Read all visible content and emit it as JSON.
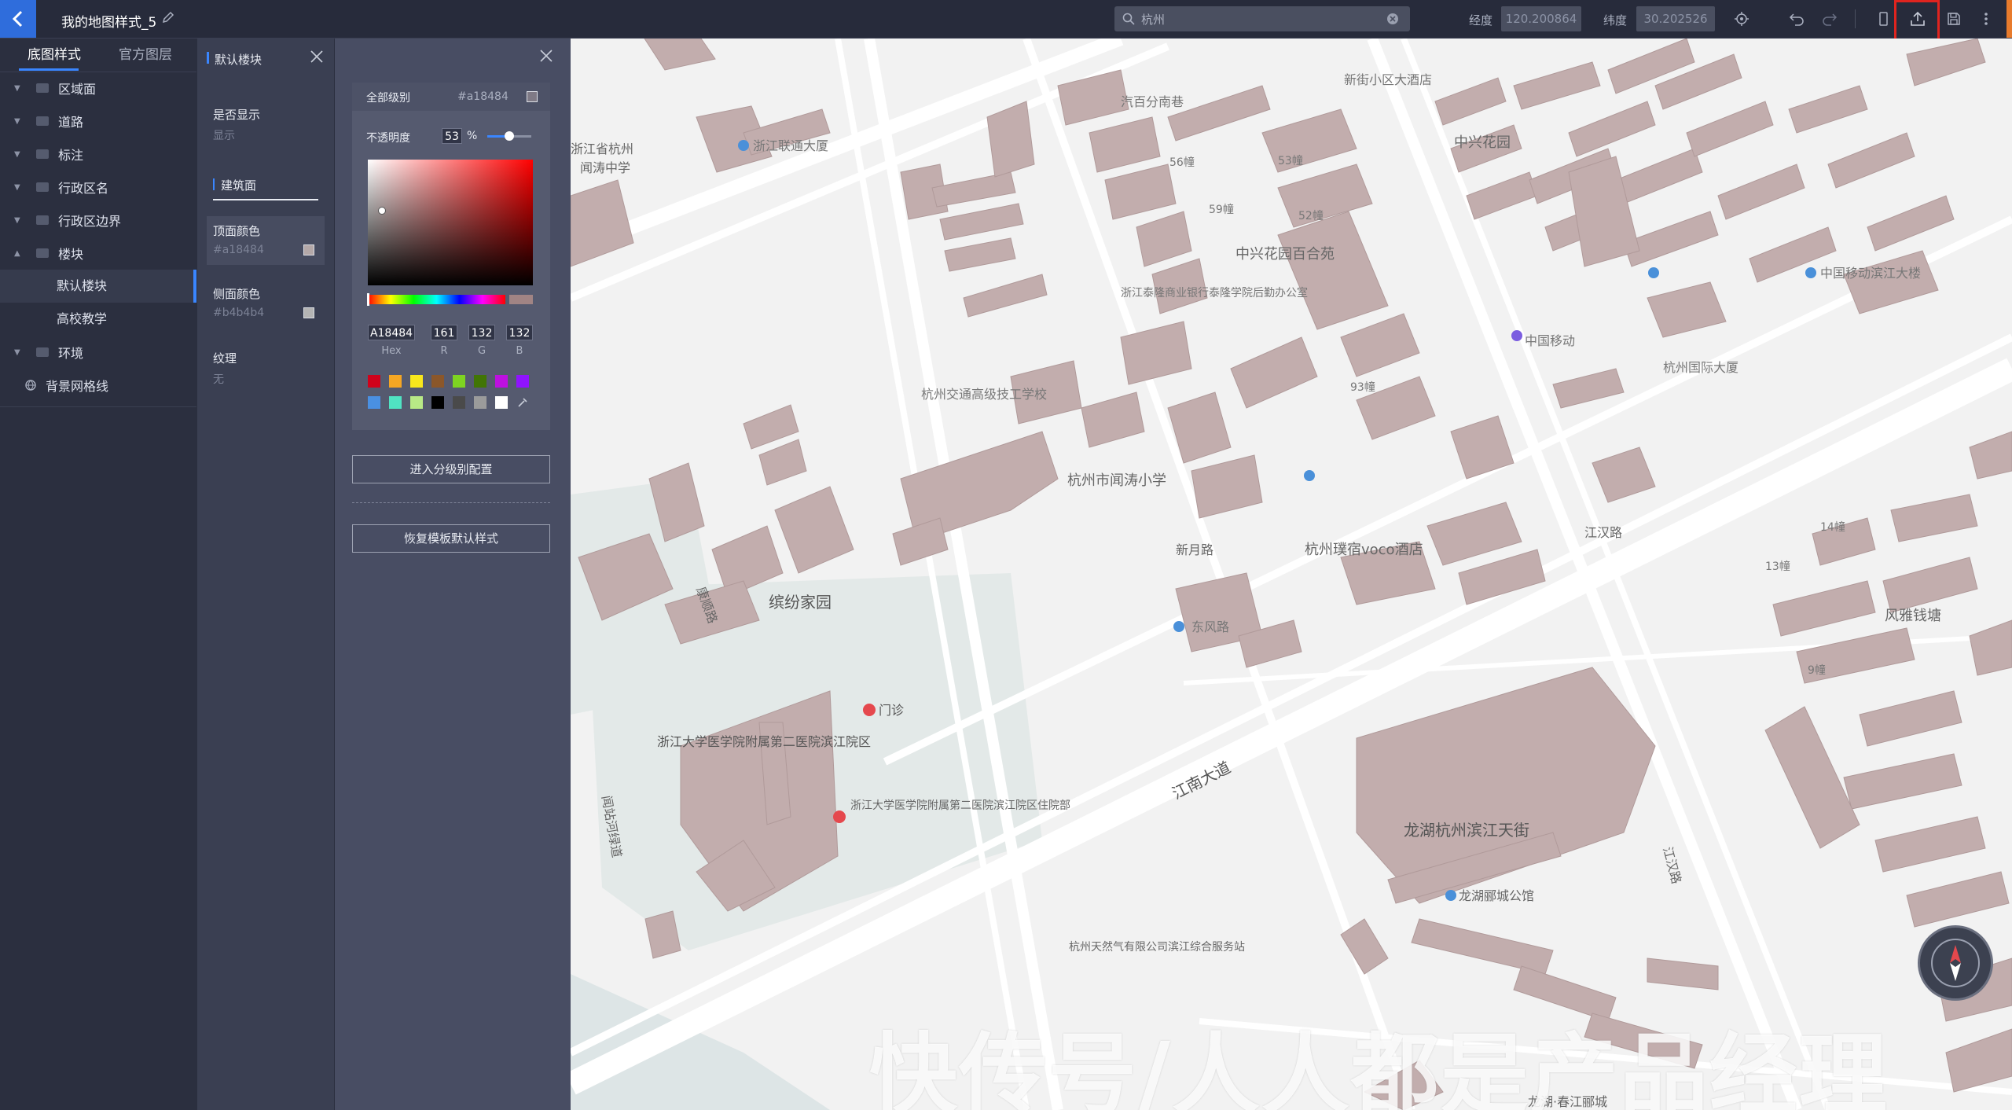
{
  "header": {
    "title": "我的地图样式_5",
    "search_value": "杭州",
    "longitude_label": "经度",
    "longitude_value": "120.200864",
    "latitude_label": "纬度",
    "latitude_value": "30.202526",
    "icons": [
      "back-icon",
      "edit-icon",
      "search-icon",
      "clear-icon",
      "locate-icon",
      "undo-icon",
      "redo-icon",
      "phone-preview-icon",
      "export-icon",
      "save-icon",
      "more-icon"
    ]
  },
  "layer_panel": {
    "tabs": [
      "底图样式",
      "官方图层"
    ],
    "items": [
      {
        "label": "区域面"
      },
      {
        "label": "道路"
      },
      {
        "label": "标注"
      },
      {
        "label": "行政区名"
      },
      {
        "label": "行政区边界"
      },
      {
        "label": "楼块"
      },
      {
        "label": "默认楼块"
      },
      {
        "label": "高校教学"
      },
      {
        "label": "环境"
      },
      {
        "label": "背景网格线"
      }
    ]
  },
  "prop_panel": {
    "title": "默认楼块",
    "visible_label": "是否显示",
    "visible_value": "显示",
    "section": "建筑面",
    "top_color_label": "顶面颜色",
    "top_color_value": "#a18484",
    "side_color_label": "侧面颜色",
    "side_color_value": "#b4b4b4",
    "texture_label": "纹理",
    "texture_value": "无"
  },
  "picker": {
    "level_label": "全部级别",
    "level_color": "#a18484",
    "opacity_label": "不透明度",
    "opacity_value": "53",
    "opacity_unit": "%",
    "hex": "A18484",
    "r": "161",
    "g": "132",
    "b": "132",
    "hex_cap": "Hex",
    "r_cap": "R",
    "g_cap": "G",
    "b_cap": "B",
    "presets": [
      "#d0021b",
      "#f5a623",
      "#f8e71c",
      "#8b572a",
      "#7ed321",
      "#417505",
      "#bd10e0",
      "#9013fe",
      "#4a90e2",
      "#50e3c2",
      "#b8e986",
      "#000000",
      "#4a4a4a",
      "#9b9b9b",
      "#ffffff"
    ],
    "btn_levels": "进入分级别配置",
    "btn_restore": "恢复模板默认样式"
  },
  "map": {
    "labels": [
      "浙江省杭州",
      "闻涛中学",
      "浙江联通大厦",
      "汽百分南巷",
      "新街小区大酒店",
      "中兴花园",
      "中兴花园百合苑",
      "浙江泰隆商业银行泰隆学院后勤办公室",
      "杭州交通高级技工学校",
      "杭州市闻涛小学",
      "中国移动",
      "杭州国际大厦",
      "中国移动滨江大楼",
      "新月路",
      "杭州璞宿voco酒店",
      "江汉路",
      "风雅钱塘",
      "康顺路",
      "缤纷家园",
      "东风路",
      "浙江大学医学院附属第二医院滨江院区",
      "门诊",
      "浙江大学医学院附属第二医院滨江院区住院部",
      "闻站河绿道",
      "江南大道",
      "龙湖杭州滨江天街",
      "龙湖郦城公馆",
      "杭州天然气有限公司滨江综合服务站",
      "江汉路",
      "龙湖·春江郦城",
      "56幢",
      "53幢",
      "59幢",
      "52幢",
      "93幢",
      "14幢",
      "13幢",
      "9幢"
    ],
    "watermark": "快传号/人人都是产品经理"
  },
  "colors": {
    "accent": "#3a86ff",
    "building": "#a18484",
    "highlight": "#e0241f"
  }
}
